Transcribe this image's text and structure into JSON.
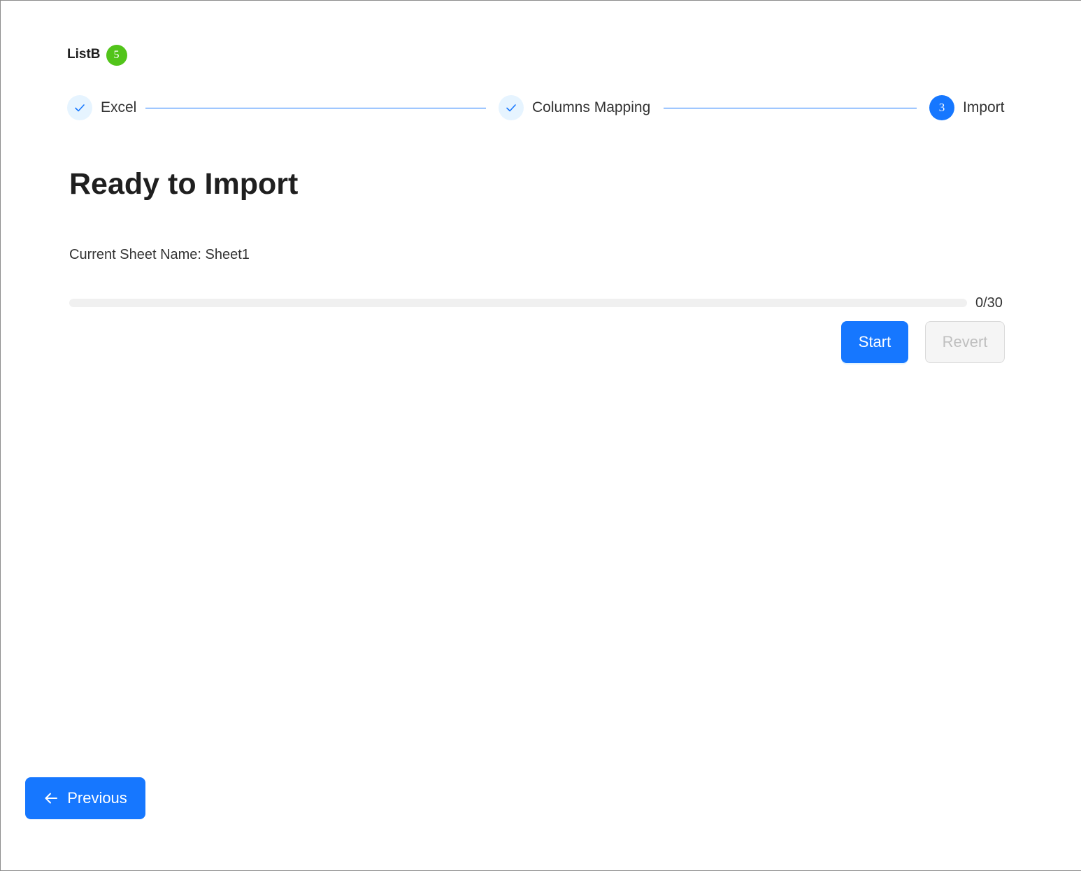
{
  "header": {
    "list_name": "ListB",
    "badge_count": "5"
  },
  "steps": [
    {
      "label": "Excel",
      "status": "done"
    },
    {
      "label": "Columns Mapping",
      "status": "done"
    },
    {
      "label": "Import",
      "status": "active",
      "number": "3"
    }
  ],
  "main": {
    "title": "Ready to Import",
    "sheet_text": "Current Sheet Name: Sheet1",
    "progress": {
      "current": 0,
      "total": 30,
      "text": "0/30"
    },
    "start_label": "Start",
    "revert_label": "Revert"
  },
  "footer": {
    "previous_label": "Previous"
  },
  "colors": {
    "primary": "#1677ff",
    "badge": "#52c41a",
    "step_done_bg": "#e6f4ff",
    "track": "#f0f0f0"
  },
  "icons": {
    "step_done": "check-icon",
    "previous": "arrow-left-icon"
  }
}
